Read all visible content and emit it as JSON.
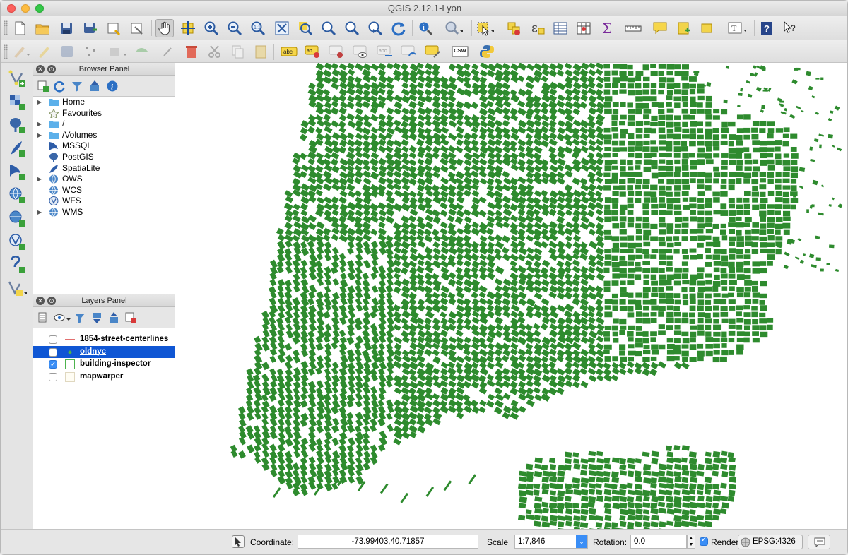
{
  "window": {
    "title": "QGIS 2.12.1-Lyon"
  },
  "browser_panel": {
    "title": "Browser Panel",
    "items": [
      {
        "label": "Home",
        "icon": "folder-icon",
        "expandable": true
      },
      {
        "label": "Favourites",
        "icon": "star-icon",
        "expandable": false
      },
      {
        "label": "/",
        "icon": "folder-icon",
        "expandable": true
      },
      {
        "label": "/Volumes",
        "icon": "folder-icon",
        "expandable": true
      },
      {
        "label": "MSSQL",
        "icon": "mssql-icon",
        "expandable": false
      },
      {
        "label": "PostGIS",
        "icon": "postgis-elephant-icon",
        "expandable": false
      },
      {
        "label": "SpatiaLite",
        "icon": "spatialite-feather-icon",
        "expandable": false
      },
      {
        "label": "OWS",
        "icon": "globe-icon",
        "expandable": true
      },
      {
        "label": "WCS",
        "icon": "globe-icon",
        "expandable": false
      },
      {
        "label": "WFS",
        "icon": "globe-icon",
        "expandable": false
      },
      {
        "label": "WMS",
        "icon": "globe-icon",
        "expandable": true
      }
    ]
  },
  "layers_panel": {
    "title": "Layers Panel",
    "layers": [
      {
        "name": "1854-street-centerlines",
        "checked": false,
        "symbol": "red-line",
        "selected": false
      },
      {
        "name": "oldnyc",
        "checked": false,
        "symbol": "green-point",
        "selected": true
      },
      {
        "name": "building-inspector",
        "checked": true,
        "symbol": "green-polygon",
        "selected": false
      },
      {
        "name": "mapwarper",
        "checked": false,
        "symbol": "raster",
        "selected": false
      }
    ]
  },
  "map": {
    "building_color": "#2e8b2e"
  },
  "statusbar": {
    "coordinate_label": "Coordinate:",
    "coordinate_value": "-73.99403,40.71857",
    "scale_label": "Scale",
    "scale_value": "1:7,846",
    "rotation_label": "Rotation:",
    "rotation_value": "0.0",
    "render_label": "Render",
    "render_checked": true,
    "crs_label": "EPSG:4326"
  },
  "toolbar_labels": {
    "csw": "CSW"
  },
  "colors": {
    "accent": "#0f56d4",
    "map_fill": "#2e8b2e"
  }
}
